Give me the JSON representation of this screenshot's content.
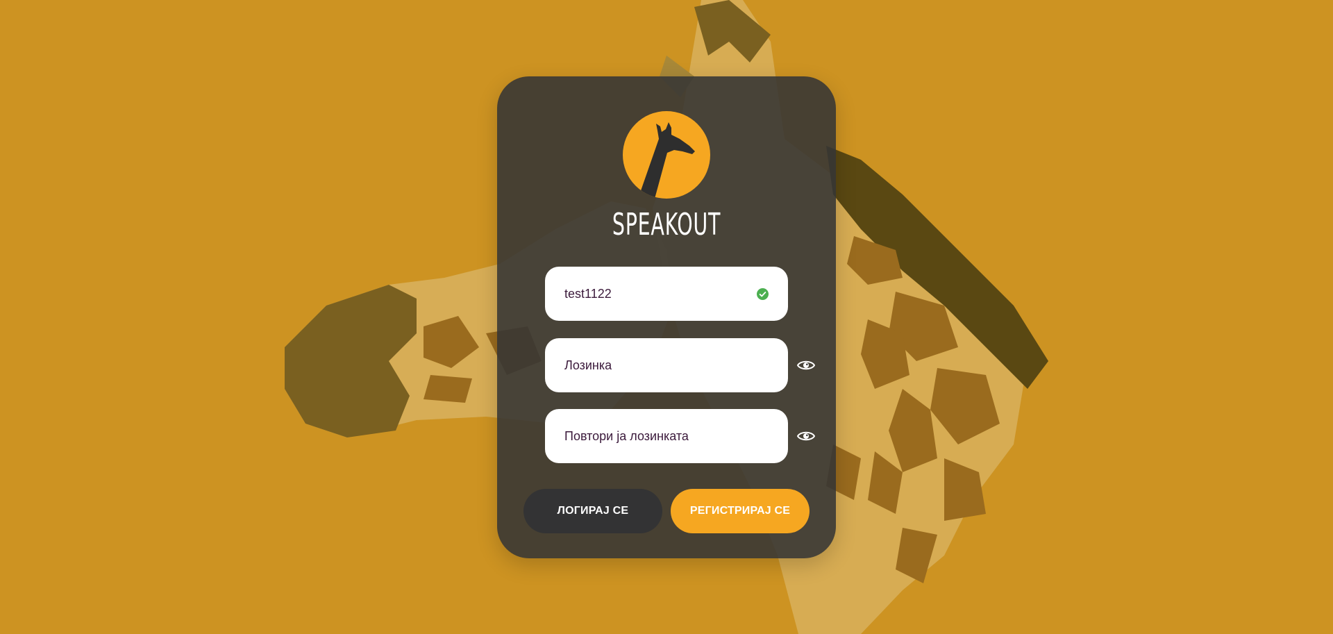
{
  "brand": {
    "name": "SPEAKOUT",
    "logo_icon": "giraffe-logo-icon"
  },
  "form": {
    "username": {
      "value": "test1122",
      "status_icon": "check-circle-icon"
    },
    "password": {
      "placeholder": "Лозинка",
      "toggle_icon": "eye-icon"
    },
    "repeat_password": {
      "placeholder": "Повтори ја лозинката",
      "toggle_icon": "eye-icon"
    }
  },
  "buttons": {
    "login_label": "ЛОГИРАЈ СЕ",
    "register_label": "РЕГИСТРИРАЈ СЕ"
  },
  "colors": {
    "background": "#CD9322",
    "card": "#343434",
    "accent": "#F6A721",
    "dark_button": "#333334",
    "field_text": "#3B1A3B",
    "check": "#4CAF50"
  }
}
